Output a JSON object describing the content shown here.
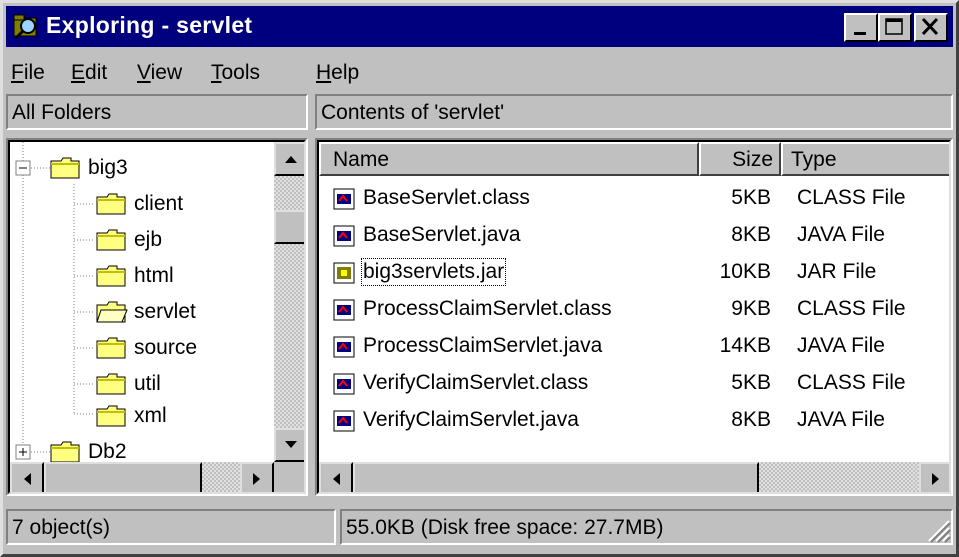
{
  "window": {
    "title": "Exploring - servlet",
    "title_icon": "explorer-magnifier-icon",
    "buttons": [
      "minimize-icon",
      "maximize-icon",
      "close-icon"
    ]
  },
  "menu": {
    "items": [
      {
        "label_first": "F",
        "label_rest": "ile"
      },
      {
        "label_first": "E",
        "label_rest": "dit"
      },
      {
        "label_first": "V",
        "label_rest": "iew"
      },
      {
        "label_first": "T",
        "label_rest": "ools"
      },
      {
        "label_first": "H",
        "label_rest": "elp"
      }
    ]
  },
  "left_pane": {
    "header": "All Folders",
    "tree": [
      {
        "label": "big3",
        "expander": "−",
        "open": false
      },
      {
        "label": "client"
      },
      {
        "label": "ejb"
      },
      {
        "label": "html"
      },
      {
        "label": "servlet",
        "open": true
      },
      {
        "label": "source"
      },
      {
        "label": "util"
      },
      {
        "label": "xml"
      },
      {
        "label": "Db2",
        "expander": "+"
      }
    ]
  },
  "right_pane": {
    "header": "Contents of 'servlet'",
    "columns": {
      "name": "Name",
      "size": "Size",
      "type": "Type"
    },
    "files": [
      {
        "name": "BaseServlet.class",
        "size": "5KB",
        "type": "CLASS File",
        "icon": "class-file-icon"
      },
      {
        "name": "BaseServlet.java",
        "size": "8KB",
        "type": "JAVA File",
        "icon": "java-file-icon"
      },
      {
        "name": "big3servlets.jar",
        "size": "10KB",
        "type": "JAR File",
        "icon": "jar-file-icon",
        "focused": true
      },
      {
        "name": "ProcessClaimServlet.class",
        "size": "9KB",
        "type": "CLASS File",
        "icon": "class-file-icon"
      },
      {
        "name": "ProcessClaimServlet.java",
        "size": "14KB",
        "type": "JAVA File",
        "icon": "java-file-icon"
      },
      {
        "name": "VerifyClaimServlet.class",
        "size": "5KB",
        "type": "CLASS File",
        "icon": "class-file-icon"
      },
      {
        "name": "VerifyClaimServlet.java",
        "size": "8KB",
        "type": "JAVA File",
        "icon": "java-file-icon"
      }
    ]
  },
  "status": {
    "objects": "7 object(s)",
    "space": "55.0KB (Disk free space: 27.7MB)"
  },
  "colors": {
    "title_bar": "#00007f",
    "face": "#c0c0c0",
    "folder": "#ffff80"
  }
}
